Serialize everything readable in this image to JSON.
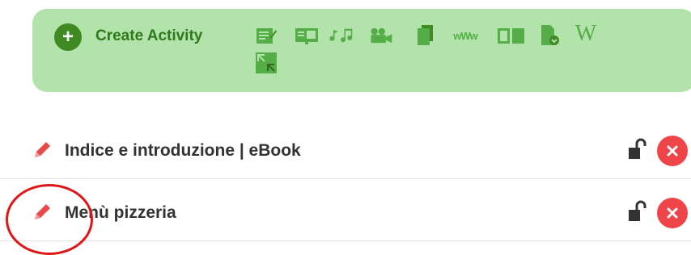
{
  "create_panel": {
    "label": "Create Activity",
    "plus_symbol": "+",
    "tools": [
      {
        "icon": "text-page-icon"
      },
      {
        "icon": "presentation-icon"
      },
      {
        "icon": "music-notes-icon"
      },
      {
        "icon": "video-camera-icon"
      },
      {
        "icon": "documents-icon"
      },
      {
        "icon": "web-link-icon",
        "text": "wWw"
      },
      {
        "icon": "ebook-icon"
      },
      {
        "icon": "file-download-icon"
      },
      {
        "icon": "wikipedia-icon",
        "text": "W"
      },
      {
        "icon": "embed-icon"
      }
    ]
  },
  "activities": [
    {
      "title": "Indice e introduzione | eBook",
      "locked": false
    },
    {
      "title": "Menù pizzeria",
      "locked": false
    }
  ],
  "colors": {
    "panel_bg": "#b2e3aa",
    "accent_green": "#3f8a22",
    "icon_green": "#55ad47",
    "delete_red": "#ef4549",
    "pencil_red": "#e84a4a",
    "annotation_red": "#e01616"
  }
}
